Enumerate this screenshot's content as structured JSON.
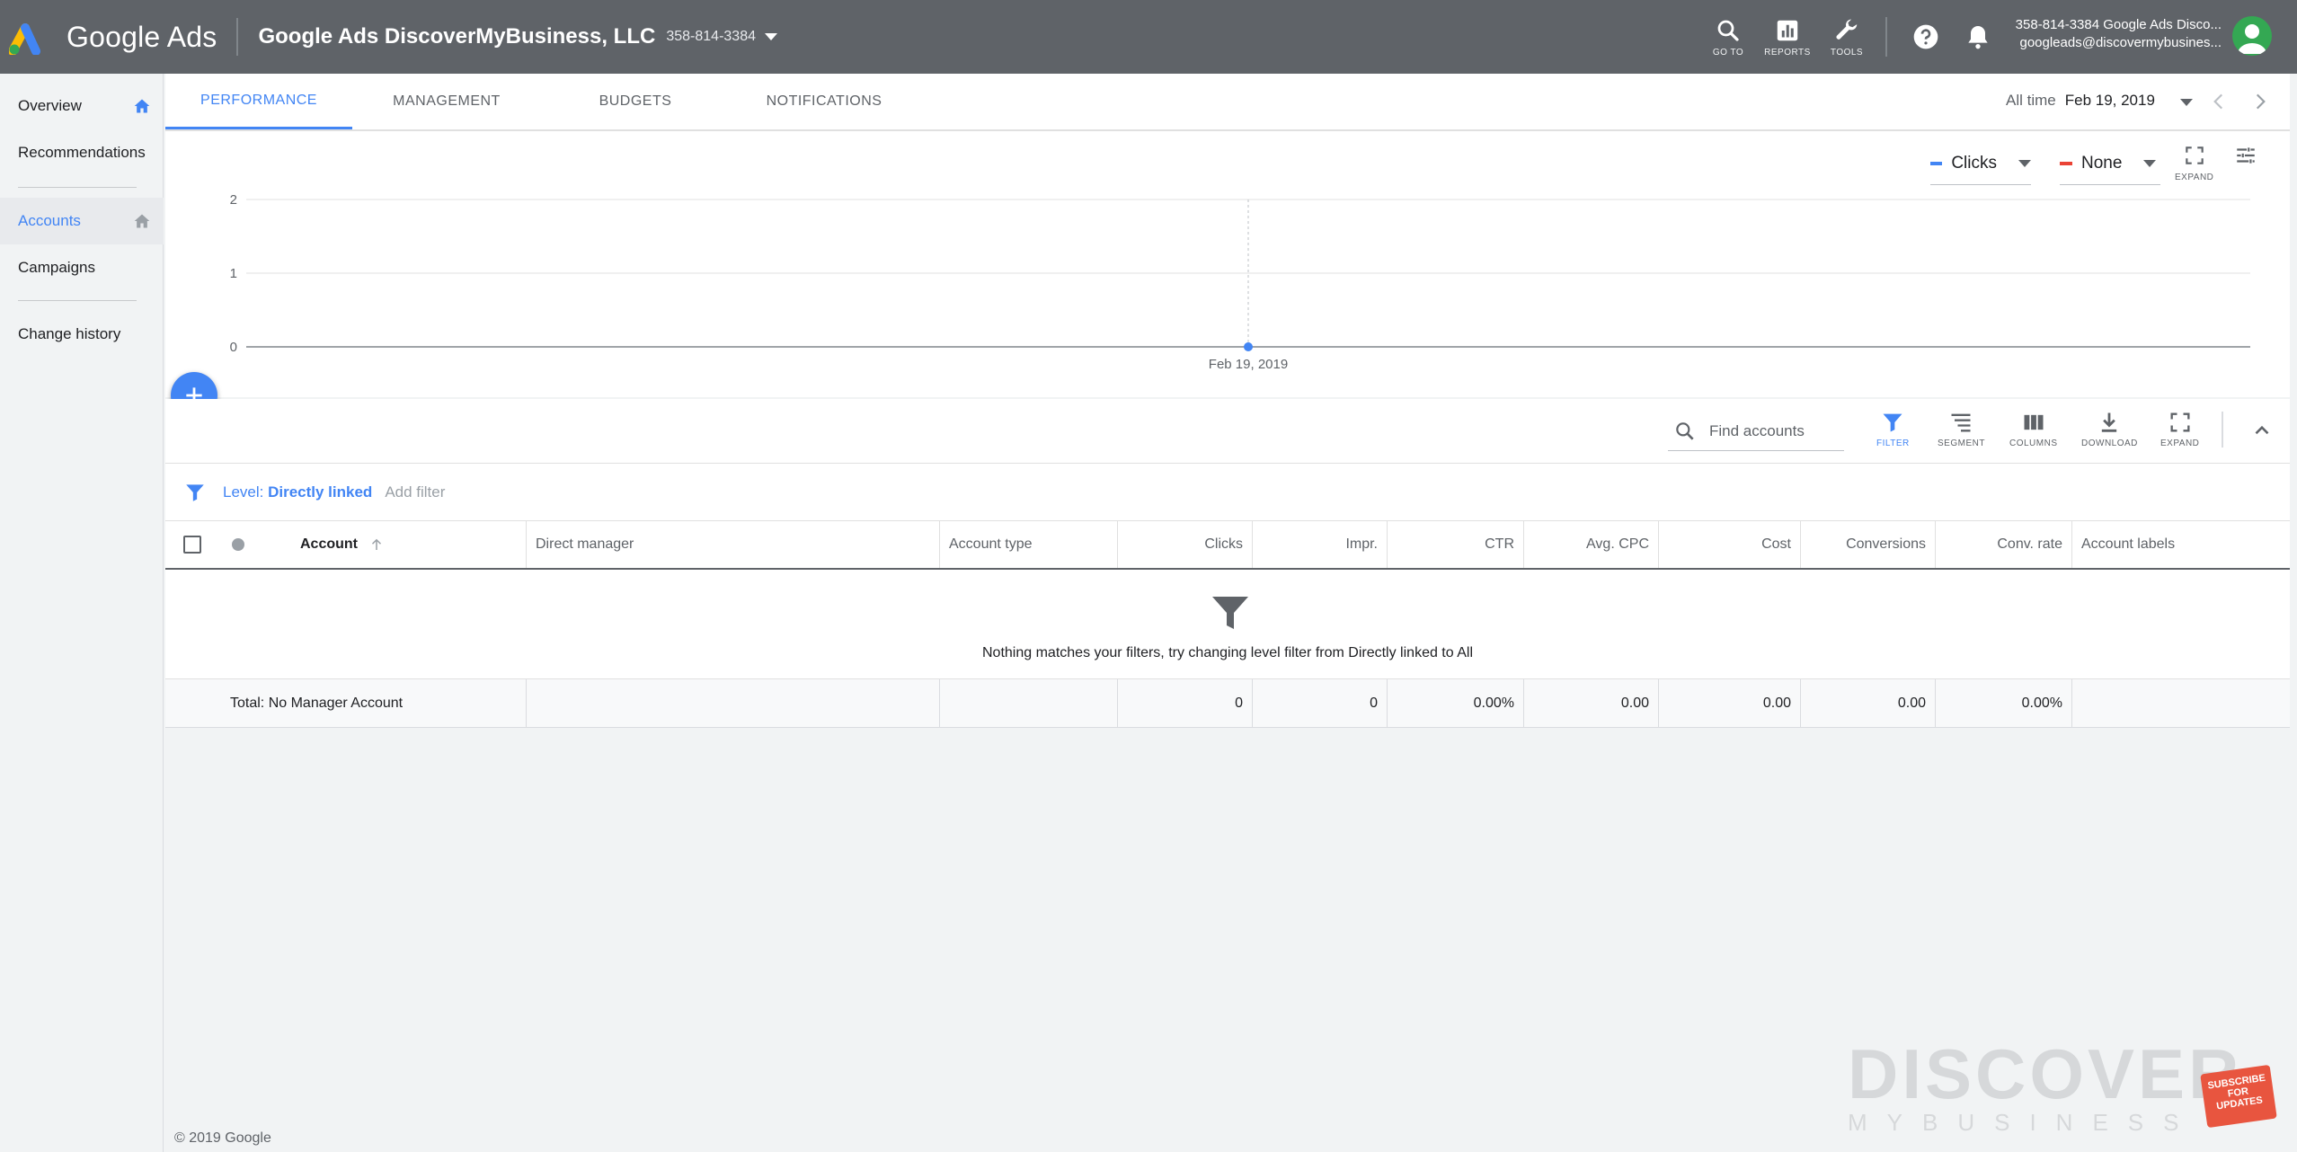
{
  "topbar": {
    "product": "Google Ads",
    "account_name": "Google Ads DiscoverMyBusiness, LLC",
    "account_id": "358-814-3384",
    "tools": [
      {
        "icon": "search-icon",
        "label": "GO TO"
      },
      {
        "icon": "reports-icon",
        "label": "REPORTS"
      },
      {
        "icon": "wrench-icon",
        "label": "TOOLS"
      }
    ],
    "user_line1": "358-814-3384 Google Ads Disco...",
    "user_line2": "googleads@discovermybusines..."
  },
  "sidebar": {
    "items": [
      {
        "label": "Overview"
      },
      {
        "label": "Recommendations"
      },
      {
        "label": "Accounts"
      },
      {
        "label": "Campaigns"
      },
      {
        "label": "Change history"
      }
    ]
  },
  "tabs": [
    {
      "label": "PERFORMANCE"
    },
    {
      "label": "MANAGEMENT"
    },
    {
      "label": "BUDGETS"
    },
    {
      "label": "NOTIFICATIONS"
    }
  ],
  "daterange": {
    "label": "All time",
    "value": "Feb 19, 2019"
  },
  "chart_controls": {
    "metric1": "Clicks",
    "metric1_color": "#4285f4",
    "metric2": "None",
    "metric2_color": "#ea4335",
    "expand_label": "EXPAND"
  },
  "chart_data": {
    "type": "line",
    "x": [
      "Feb 19, 2019"
    ],
    "series": [
      {
        "name": "Clicks",
        "values": [
          0
        ]
      }
    ],
    "yticks": [
      0,
      1,
      2
    ],
    "ylim": [
      0,
      2
    ],
    "xticks": [
      "Feb 19, 2019"
    ]
  },
  "table_toolbar": {
    "search_placeholder": "Find accounts",
    "buttons": [
      {
        "label": "FILTER"
      },
      {
        "label": "SEGMENT"
      },
      {
        "label": "COLUMNS"
      },
      {
        "label": "DOWNLOAD"
      },
      {
        "label": "EXPAND"
      }
    ]
  },
  "filter": {
    "level_prefix": "Level: ",
    "level_value": "Directly linked",
    "add_filter": "Add filter"
  },
  "table": {
    "columns": [
      "Account",
      "Direct manager",
      "Account type",
      "Clicks",
      "Impr.",
      "CTR",
      "Avg. CPC",
      "Cost",
      "Conversions",
      "Conv. rate",
      "Account labels"
    ],
    "empty_message": "Nothing matches your filters, try changing level filter from Directly linked to All",
    "total_row": [
      "Total: No Manager Account",
      "",
      "",
      "0",
      "0",
      "0.00%",
      "0.00",
      "0.00",
      "0.00",
      "0.00%",
      ""
    ]
  },
  "footer": "© 2019 Google",
  "watermark": {
    "main": "DISCOVER",
    "sub": "MYBUSINESS",
    "badge": "SUBSCRIBE FOR UPDATES"
  }
}
